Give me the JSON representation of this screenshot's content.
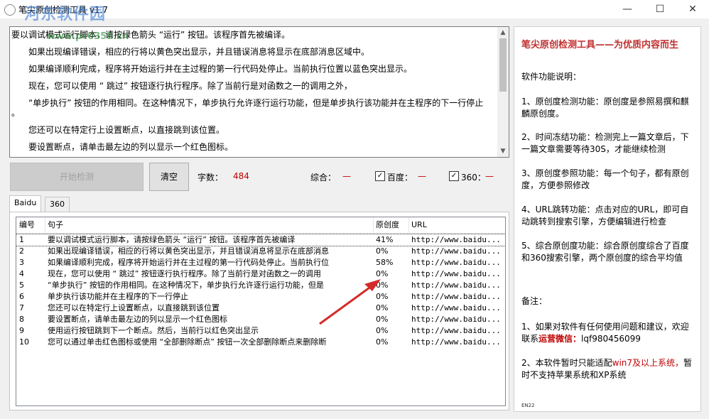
{
  "window": {
    "title": "笔尖原创检测工具 v1.7",
    "watermark": "河东软件园",
    "watermark_url": "www.pc0359.cn",
    "minimize": "—",
    "maximize": "☐",
    "close": "✕"
  },
  "editor": {
    "lines": [
      "要以调试模式运行脚本，请按绿色箭头 “运行” 按钮。该程序首先被编译。",
      "如果出现编译错误，相应的行将以黄色突出显示，并且错误消息将显示在底部消息区域中。",
      "如果编译顺利完成，程序将开始运行并在主过程的第一行代码处停止。当前执行位置以蓝色突出显示。",
      "现在，您可以使用 “ 跳过” 按钮逐行执行程序。除了当前行是对函数之一的调用之外，",
      "“单步执行” 按钮的作用相同。在这种情况下，单步执行允许逐行运行功能，但是单步执行该功能并在主程序的下一行停止",
      "。",
      "您还可以在特定行上设置断点，以直接跳到该位置。",
      "要设置断点，请单击最左边的列以显示一个红色图标。"
    ]
  },
  "toolbar": {
    "start_label": "开始检测",
    "clear_label": "清空",
    "wordcount_label": "字数：",
    "wordcount_value": "484",
    "overall_label": "综合：",
    "overall_value": "—",
    "baidu_label": "百度：",
    "baidu_value": "—",
    "s360_label": "360：",
    "s360_value": "—"
  },
  "tabs": [
    {
      "label": "Baidu",
      "active": true
    },
    {
      "label": "360",
      "active": false
    }
  ],
  "table": {
    "columns": [
      "编号",
      "句子",
      "原创度",
      "URL"
    ],
    "rows": [
      {
        "num": "1",
        "sentence": "要以调试模式运行脚本，请按绿色箭头 “运行” 按钮。该程序首先被编译",
        "orig": "41%",
        "url": "http://www.baidu..."
      },
      {
        "num": "2",
        "sentence": "如果出现编译错误，相应的行将以黄色突出显示，并且错误消息将显示在底部消息",
        "orig": "0%",
        "url": "http://www.baidu..."
      },
      {
        "num": "3",
        "sentence": "如果编译顺利完成，程序将开始运行并在主过程的第一行代码处停止。当前执行位",
        "orig": "58%",
        "url": "http://www.baidu..."
      },
      {
        "num": "4",
        "sentence": "现在，您可以使用 “ 跳过” 按钮逐行执行程序。除了当前行是对函数之一的调用",
        "orig": "0%",
        "url": "http://www.baidu..."
      },
      {
        "num": "5",
        "sentence": "“单步执行” 按钮的作用相同。在这种情况下，单步执行允许逐行运行功能，但是",
        "orig": "0%",
        "url": "http://www.baidu..."
      },
      {
        "num": "6",
        "sentence": "单步执行该功能并在主程序的下一行停止",
        "orig": "0%",
        "url": "http://www.baidu..."
      },
      {
        "num": "7",
        "sentence": "您还可以在特定行上设置断点，以直接跳到该位置",
        "orig": "0%",
        "url": "http://www.baidu..."
      },
      {
        "num": "8",
        "sentence": "要设置断点，请单击最左边的列以显示一个红色图标",
        "orig": "0%",
        "url": "http://www.baidu..."
      },
      {
        "num": "9",
        "sentence": "使用运行按钮跳到下一个断点。然后，当前行以红色突出显示",
        "orig": "0%",
        "url": "http://www.baidu..."
      },
      {
        "num": "10",
        "sentence": "您可以通过单击红色图标或使用 “全部删除断点” 按钮一次全部删除断点来删除断",
        "orig": "0%",
        "url": "http://www.baidu..."
      }
    ]
  },
  "right_panel": {
    "title": "笔尖原创检测工具——为优质内容而生",
    "heading": "软件功能说明：",
    "features": [
      "1、原创度检测功能：原创度是参照易撰和麒麟原创度。",
      "2、时间冻结功能：检测完上一篇文章后，下一篇文章需要等待30S，才能继续检测",
      "3、原创度参照功能：每一个句子，都有原创度，方便参照修改",
      "4、URL跳转功能：点击对应的URL，即可自动跳转到搜索引擎，方便编辑进行检查",
      "5、综合原创度功能：综合原创度综合了百度和360搜索引擎，两个原创度的综合平均值"
    ],
    "notes_heading": "备注：",
    "note1_prefix": "1、如果对软件有任何使用问题和建议，欢迎联系",
    "note1_wechat": "运营微信：",
    "note1_id": "lqf980456099",
    "note2_prefix": "2、本软件暂时只能适配",
    "note2_highlight": "win7及以上系统，",
    "note2_suffix": "暂时不支持苹果系统和XP系统",
    "footer": "EN22"
  },
  "colors": {
    "accent_red": "#c03030",
    "highlight_red": "#c00000",
    "arrow": "#d42a2a"
  }
}
